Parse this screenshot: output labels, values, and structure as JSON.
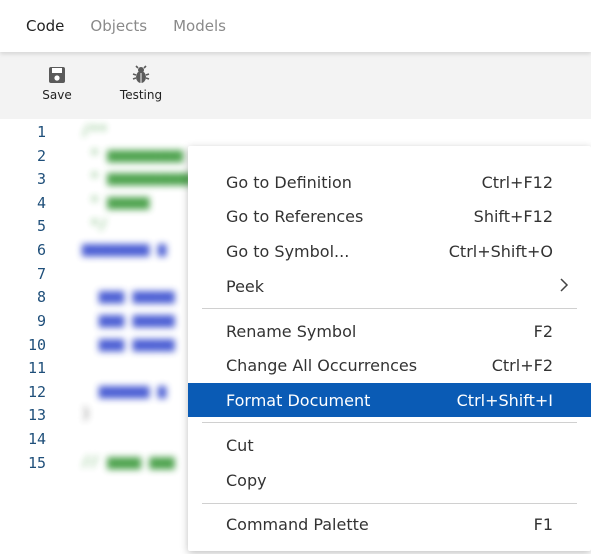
{
  "tabs": [
    "Code",
    "Objects",
    "Models"
  ],
  "toolbar": {
    "save_label": "Save",
    "testing_label": "Testing"
  },
  "line_numbers": [
    "1",
    "2",
    "3",
    "4",
    "5",
    "6",
    "7",
    "8",
    "9",
    "10",
    "11",
    "12",
    "13",
    "14",
    "15"
  ],
  "context_menu": {
    "items": [
      {
        "label": "Go to Definition",
        "shortcut": "Ctrl+F12"
      },
      {
        "label": "Go to References",
        "shortcut": "Shift+F12"
      },
      {
        "label": "Go to Symbol...",
        "shortcut": "Ctrl+Shift+O"
      },
      {
        "label": "Peek",
        "shortcut": ""
      },
      {
        "label": "Rename Symbol",
        "shortcut": "F2"
      },
      {
        "label": "Change All Occurrences",
        "shortcut": "Ctrl+F2"
      },
      {
        "label": "Format Document",
        "shortcut": "Ctrl+Shift+I"
      },
      {
        "label": "Cut",
        "shortcut": ""
      },
      {
        "label": "Copy",
        "shortcut": ""
      },
      {
        "label": "Command Palette",
        "shortcut": "F1"
      }
    ],
    "highlighted_index": 6
  },
  "colors": {
    "highlight": "#0a5bb5",
    "line_number": "#1f4f7a",
    "toolbar_bg": "#f3f3f3"
  },
  "icons": {
    "save": "floppy-disk-icon",
    "testing": "bug-icon",
    "peek_submenu": "chevron-right-icon"
  }
}
